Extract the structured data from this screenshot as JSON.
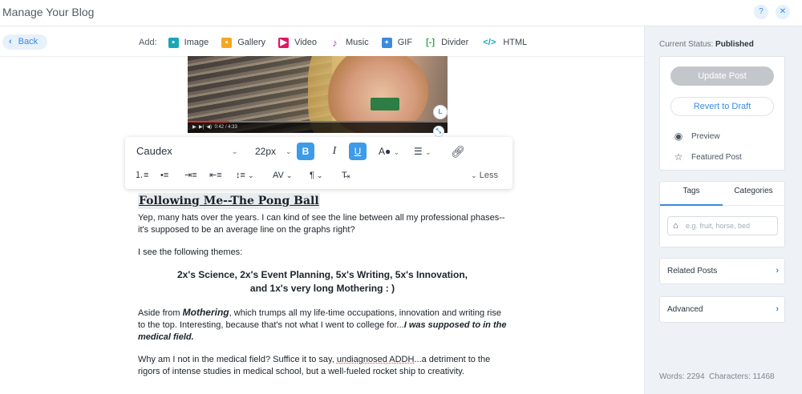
{
  "header": {
    "title": "Manage Your Blog",
    "help_label": "?",
    "close_label": "✕"
  },
  "back": {
    "label": "Back"
  },
  "add_bar": {
    "label": "Add:",
    "items": [
      {
        "label": "Image",
        "icon": "image-icon",
        "color": "#1aa6b7"
      },
      {
        "label": "Gallery",
        "icon": "gallery-icon",
        "color": "#f5a623"
      },
      {
        "label": "Video",
        "icon": "video-icon",
        "color": "#e0175f"
      },
      {
        "label": "Music",
        "icon": "music-icon",
        "color": "#9b3fc8"
      },
      {
        "label": "GIF",
        "icon": "gif-icon",
        "color": "#3a8be0"
      },
      {
        "label": "Divider",
        "icon": "divider-icon",
        "color": "#34a853"
      },
      {
        "label": "HTML",
        "icon": "html-icon",
        "color": "#1aa6b7"
      }
    ]
  },
  "video": {
    "time": "0:42 / 4:33",
    "progress": 0.16,
    "align_badge": "L"
  },
  "toolbar": {
    "font": "Caudex",
    "size": "22px",
    "bold": "B",
    "italic": "I",
    "underline": "U",
    "color_label": "A",
    "less_label": "Less"
  },
  "post": {
    "title": "Following Me--The Pong Ball",
    "p1": "Yep, many hats over the years. I can kind of see the line between all my professional phases--it's supposed to be an average line on the graphs right?",
    "p2": "I see the following themes:",
    "themes_line1": "2x's Science, 2x's Event Planning, 5x's Writing, 5x's Innovation,",
    "themes_line2": "and 1x's very long Mothering : )",
    "p3_start": "Aside from ",
    "p3_mothering": "Mothering",
    "p3_mid": ", which trumps all my life-time occupations, innovation and writing rise to the top. Interesting, because that's not what I went to college for...",
    "p3_em": "I was supposed to in the medical field.",
    "p4_start": "Why am I not in the medical field? Suffice it to say, ",
    "p4_squig": "undiagnosed ADDH",
    "p4_end": "...a detriment to the rigors of intense studies in medical school, but a well-fueled rocket ship to creativity."
  },
  "sidebar": {
    "status_label": "Current Status:",
    "status_value": "Published",
    "update_label": "Update Post",
    "revert_label": "Revert to Draft",
    "preview_label": "Preview",
    "featured_label": "Featured Post",
    "tab_tags": "Tags",
    "tab_categories": "Categories",
    "tags_placeholder": "e.g. fruit, horse, bed",
    "related_label": "Related Posts",
    "advanced_label": "Advanced",
    "words_label": "Words: 2294",
    "chars_label": "Characters: 11468"
  }
}
